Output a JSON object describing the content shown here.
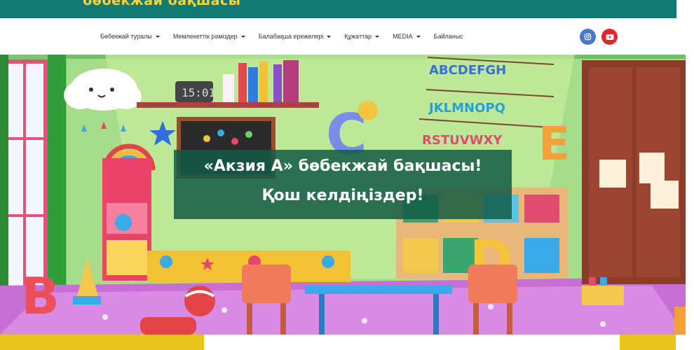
{
  "header": {
    "site_title": "бөбекжай бақшасы"
  },
  "nav": {
    "items": [
      {
        "label": "Бөбекжай туралы",
        "has_dropdown": true
      },
      {
        "label": "Мемлекеттік рәміздер",
        "has_dropdown": true
      },
      {
        "label": "Балабақша ережелері",
        "has_dropdown": true
      },
      {
        "label": "Құжаттар",
        "has_dropdown": true
      },
      {
        "label": "MEDIA",
        "has_dropdown": true
      },
      {
        "label": "Байланыс",
        "has_dropdown": false
      }
    ],
    "social": [
      {
        "icon": "instagram-icon",
        "color": "#4a74d6"
      },
      {
        "icon": "youtube-icon",
        "color": "#e3262b"
      }
    ]
  },
  "hero": {
    "line1": "«Акзия А» бөбекжай бақшасы!",
    "line2": "Қош келдіңіздер!",
    "clock_text": "15:01",
    "alphabet_row1": "ABCDEFGH",
    "alphabet_row2": "JKLMNOPQ",
    "alphabet_row3": "RSTUVWXY",
    "letters": [
      "B",
      "C",
      "D",
      "E"
    ]
  },
  "colors": {
    "header": "#0f7a73",
    "title": "#ffd23a",
    "accent_yellow": "#e8c41c"
  }
}
